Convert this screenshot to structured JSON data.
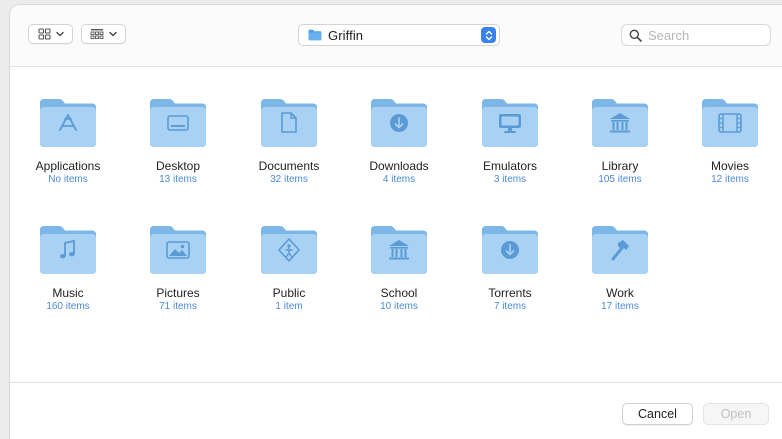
{
  "toolbar": {
    "view_icons_icon": "icon-grid-icon",
    "view_groups_icon": "gallery-grid-icon",
    "location": "Griffin",
    "search_placeholder": "Search"
  },
  "colors": {
    "folder_light": "#a8d1f3",
    "folder_dark": "#7db7e8",
    "folder_symbol": "#5a9bd6",
    "accent": "#3b82f0",
    "count_text": "#4b8ad8"
  },
  "folders": [
    {
      "name": "Applications",
      "count": "No items",
      "symbol": "app-store-icon"
    },
    {
      "name": "Desktop",
      "count": "13 items",
      "symbol": "desktop-icon"
    },
    {
      "name": "Documents",
      "count": "32 items",
      "symbol": "document-icon"
    },
    {
      "name": "Downloads",
      "count": "4 items",
      "symbol": "download-icon"
    },
    {
      "name": "Emulators",
      "count": "3 items",
      "symbol": "monitor-icon"
    },
    {
      "name": "Library",
      "count": "105 items",
      "symbol": "library-icon"
    },
    {
      "name": "Movies",
      "count": "12 items",
      "symbol": "film-icon"
    },
    {
      "name": "Music",
      "count": "160 items",
      "symbol": "music-note-icon"
    },
    {
      "name": "Pictures",
      "count": "71 items",
      "symbol": "photo-icon"
    },
    {
      "name": "Public",
      "count": "1 item",
      "symbol": "public-icon"
    },
    {
      "name": "School",
      "count": "10 items",
      "symbol": "library-icon"
    },
    {
      "name": "Torrents",
      "count": "7 items",
      "symbol": "download-icon"
    },
    {
      "name": "Work",
      "count": "17 items",
      "symbol": "hammer-icon"
    }
  ],
  "footer": {
    "cancel_label": "Cancel",
    "open_label": "Open"
  }
}
